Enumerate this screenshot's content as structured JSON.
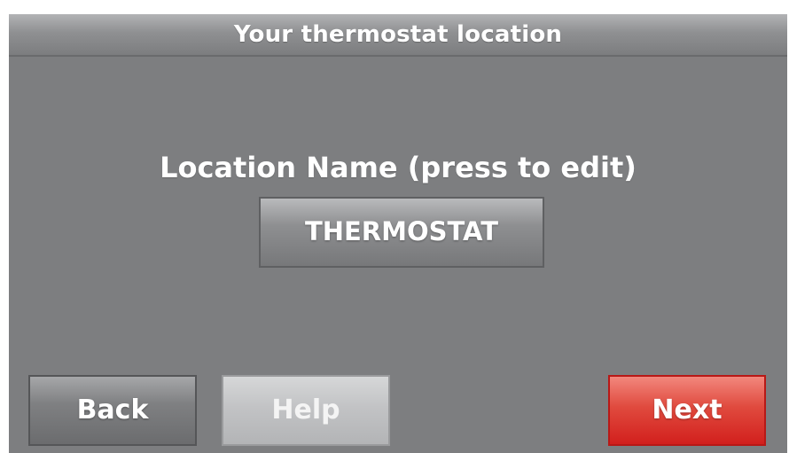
{
  "header": {
    "title": "Your thermostat location"
  },
  "main": {
    "location_label": "Location Name (press to edit)",
    "location_name": "THERMOSTAT"
  },
  "footer": {
    "back_label": "Back",
    "help_label": "Help",
    "next_label": "Next"
  },
  "colors": {
    "screen_background": "#7d7e80",
    "next_button": "#d2201d"
  }
}
